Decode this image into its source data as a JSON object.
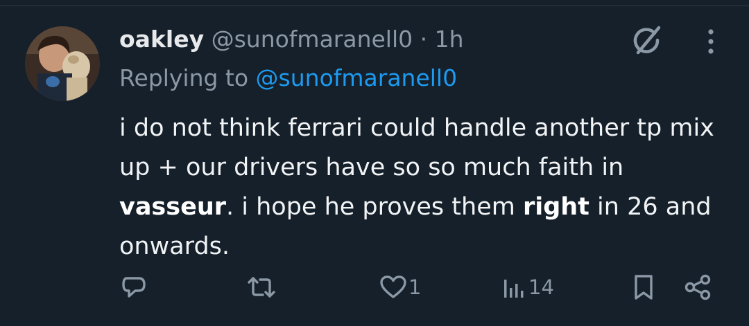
{
  "tweet": {
    "display_name": "oakley",
    "handle": "@sunofmaranell0",
    "separator": "·",
    "time": "1h",
    "replying_prefix": "Replying to",
    "replying_handle": "@sunofmaranell0",
    "text": {
      "part1": "i do not think ferrari could handle another tp mix up + our drivers have so so much faith in ",
      "bold1": "vasseur",
      "part2": ". i hope he proves them ",
      "bold2": "right",
      "part3": " in 26 and onwards."
    }
  },
  "actions": {
    "reply_count": "",
    "retweet_count": "",
    "like_count": "1",
    "view_count": "14"
  },
  "icons": {
    "reply": "reply-icon",
    "retweet": "retweet-icon",
    "like": "heart-icon",
    "views": "views-icon",
    "bookmark": "bookmark-icon",
    "share": "share-icon",
    "grok": "grok-icon",
    "more": "more-icon"
  },
  "colors": {
    "background": "#15202b",
    "text": "#e7e9ea",
    "muted": "#8b98a5",
    "link": "#1d9bf0"
  }
}
